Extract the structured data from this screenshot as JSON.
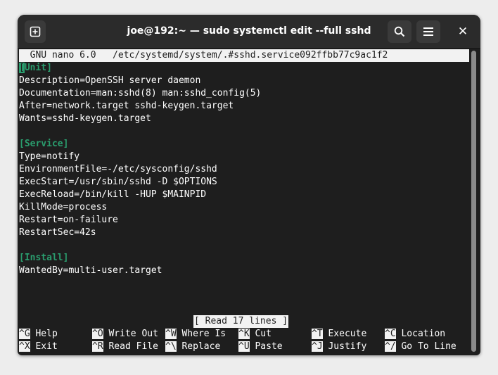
{
  "window": {
    "title": "joe@192:~ — sudo systemctl edit --full sshd"
  },
  "colors": {
    "terminal_bg": "#1e1e1e",
    "section_green": "#2a9d6e",
    "header_bg": "#f2f2f2"
  },
  "icons": {
    "new_tab": "plus-in-square-icon",
    "search": "search-icon",
    "menu": "hamburger-menu-icon",
    "close": "close-icon"
  },
  "nano": {
    "header": "  GNU nano 6.0   /etc/systemd/system/.#sshd.service092ffbb77c9ac1f2",
    "cursor_char": "[",
    "first_line_rest": "Unit]",
    "lines": [
      "Description=OpenSSH server daemon",
      "Documentation=man:sshd(8) man:sshd_config(5)",
      "After=network.target sshd-keygen.target",
      "Wants=sshd-keygen.target",
      "",
      "[Service]",
      "Type=notify",
      "EnvironmentFile=-/etc/sysconfig/sshd",
      "ExecStart=/usr/sbin/sshd -D $OPTIONS",
      "ExecReload=/bin/kill -HUP $MAINPID",
      "KillMode=process",
      "Restart=on-failure",
      "RestartSec=42s",
      "",
      "[Install]",
      "WantedBy=multi-user.target"
    ],
    "status": "[ Read 17 lines ]",
    "shortcuts_row1": [
      {
        "key": "^G",
        "label": "Help"
      },
      {
        "key": "^O",
        "label": "Write Out"
      },
      {
        "key": "^W",
        "label": "Where Is"
      },
      {
        "key": "^K",
        "label": "Cut"
      },
      {
        "key": "^T",
        "label": "Execute"
      },
      {
        "key": "^C",
        "label": "Location"
      }
    ],
    "shortcuts_row2": [
      {
        "key": "^X",
        "label": "Exit"
      },
      {
        "key": "^R",
        "label": "Read File"
      },
      {
        "key": "^\\",
        "label": "Replace"
      },
      {
        "key": "^U",
        "label": "Paste"
      },
      {
        "key": "^J",
        "label": "Justify"
      },
      {
        "key": "^/",
        "label": "Go To Line"
      }
    ]
  }
}
